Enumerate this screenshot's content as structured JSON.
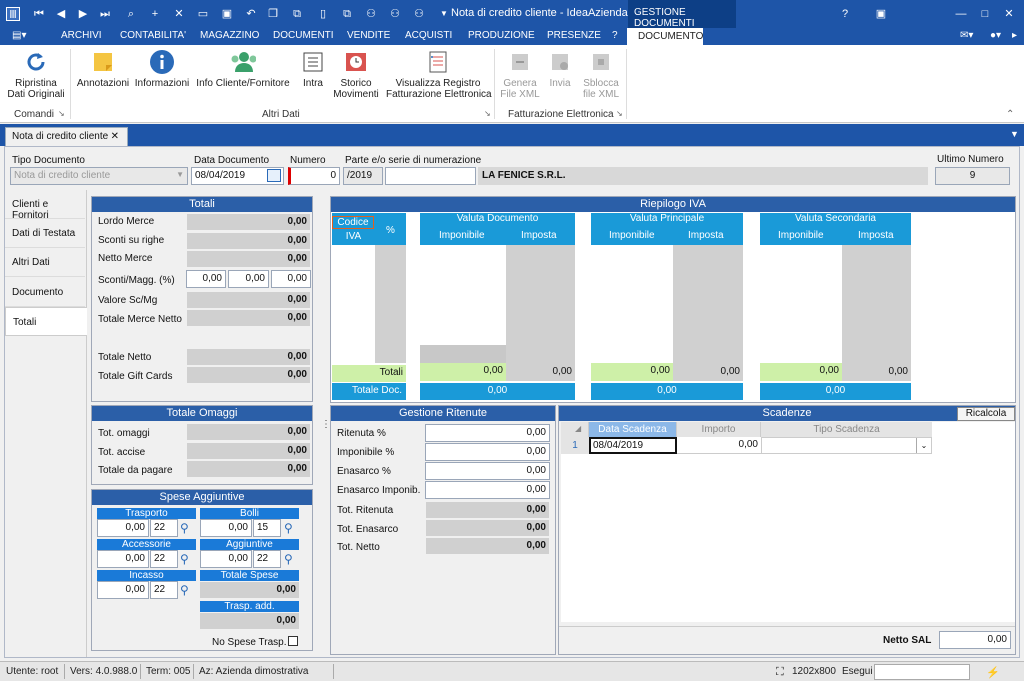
{
  "window": {
    "title": "Nota di credito cliente - IdeaAzienda.NE...",
    "context_tab": "GESTIONE DOCUMENTI"
  },
  "menu": [
    "ARCHIVI",
    "CONTABILITA'",
    "MAGAZZINO",
    "DOCUMENTI",
    "VENDITE",
    "ACQUISTI",
    "PRODUZIONE",
    "PRESENZE",
    "?",
    "DOCUMENTO"
  ],
  "ribbon": {
    "buttons": [
      {
        "label": "Ripristina\nDati Originali",
        "icon": "refresh-icon"
      },
      {
        "label": "Annotazioni",
        "icon": "sticky-note-icon"
      },
      {
        "label": "Informazioni",
        "icon": "info-icon"
      },
      {
        "label": "Info Cliente/Fornitore",
        "icon": "users-icon"
      },
      {
        "label": "Intra",
        "icon": "document-lines-icon"
      },
      {
        "label": "Storico\nMovimenti",
        "icon": "history-icon"
      },
      {
        "label": "Visualizza Registro\nFatturazione Elettronica",
        "icon": "register-icon"
      },
      {
        "label": "Genera\nFile XML",
        "icon": "generate-xml-icon"
      },
      {
        "label": "Invia",
        "icon": "send-icon"
      },
      {
        "label": "Sblocca\nfile XML",
        "icon": "unlock-xml-icon"
      }
    ],
    "groups": [
      "Comandi",
      "Altri Dati",
      "Fatturazione Elettronica"
    ]
  },
  "doc_tab": "Nota di credito cliente",
  "header": {
    "tipo_label": "Tipo Documento",
    "tipo_value": "Nota di credito cliente",
    "data_label": "Data Documento",
    "data_value": "08/04/2019",
    "numero_label": "Numero",
    "numero_value": "0",
    "serie_label": "Parte e/o serie di numerazione",
    "serie_value": "/2019",
    "serie_extra": "",
    "cliente": "LA FENICE S.R.L.",
    "ultimo_label": "Ultimo Numero",
    "ultimo_value": "9"
  },
  "side_tabs": [
    "Clienti e Fornitori",
    "Dati di Testata",
    "Altri Dati",
    "Documento",
    "Totali"
  ],
  "totali": {
    "title": "Totali",
    "rows": [
      {
        "label": "Lordo Merce",
        "value": "0,00"
      },
      {
        "label": "Sconti su righe",
        "value": "0,00"
      },
      {
        "label": "Netto Merce",
        "value": "0,00"
      },
      {
        "label": "Valore Sc/Mg",
        "value": "0,00"
      },
      {
        "label": "Totale Merce Netto",
        "value": "0,00"
      },
      {
        "label": "Totale Netto",
        "value": "0,00"
      },
      {
        "label": "Totale Gift Cards",
        "value": "0,00"
      }
    ],
    "sconti_label": "Sconti/Magg. (%)",
    "sconti": [
      "0,00",
      "0,00",
      "0,00"
    ]
  },
  "omaggi": {
    "title": "Totale Omaggi",
    "rows": [
      {
        "label": "Tot. omaggi",
        "value": "0,00"
      },
      {
        "label": "Tot. accise",
        "value": "0,00"
      },
      {
        "label": "Totale da pagare",
        "value": "0,00"
      }
    ]
  },
  "spese": {
    "title": "Spese Aggiuntive",
    "trasporto_label": "Trasporto",
    "trasporto": "0,00",
    "trasporto_iva": "22",
    "bolli_label": "Bolli",
    "bolli": "0,00",
    "bolli_iva": "15",
    "accessorie_label": "Accessorie",
    "accessorie": "0,00",
    "accessorie_iva": "22",
    "aggiuntive_label": "Aggiuntive",
    "aggiuntive": "0,00",
    "aggiuntive_iva": "22",
    "incasso_label": "Incasso",
    "incasso": "0,00",
    "incasso_iva": "22",
    "totale_label": "Totale Spese",
    "totale": "0,00",
    "trasp_add_label": "Trasp. add.",
    "trasp_add": "0,00",
    "no_spese_label": "No Spese Trasp."
  },
  "iva": {
    "title": "Riepilogo IVA",
    "codice": "Codice",
    "iva": "IVA",
    "perc": "%",
    "valuta_doc": "Valuta Documento",
    "valuta_princ": "Valuta Principale",
    "valuta_sec": "Valuta Secondaria",
    "imponibile": "Imponibile",
    "imposta": "Imposta",
    "totali_label": "Totali",
    "totale_doc_label": "Totale Doc.",
    "doc_imp": "0,00",
    "doc_imposta": "0,00",
    "doc_tot": "0,00",
    "princ_imp": "0,00",
    "princ_imposta": "0,00",
    "princ_tot": "0,00",
    "sec_imp": "0,00",
    "sec_imposta": "0,00",
    "sec_tot": "0,00"
  },
  "ritenute": {
    "title": "Gestione Ritenute",
    "inputs": [
      {
        "label": "Ritenuta %",
        "value": "0,00"
      },
      {
        "label": "Imponibile %",
        "value": "0,00"
      },
      {
        "label": "Enasarco %",
        "value": "0,00"
      },
      {
        "label": "Enasarco Imponib.",
        "value": "0,00"
      }
    ],
    "totals": [
      {
        "label": "Tot. Ritenuta",
        "value": "0,00"
      },
      {
        "label": "Tot. Enasarco",
        "value": "0,00"
      },
      {
        "label": "Tot. Netto",
        "value": "0,00"
      }
    ]
  },
  "scadenze": {
    "title": "Scadenze",
    "ricalcola": "Ricalcola",
    "cols": [
      "Data Scadenza",
      "Importo",
      "Tipo Scadenza"
    ],
    "row": {
      "num": "1",
      "data": "08/04/2019",
      "importo": "0,00",
      "tipo": ""
    },
    "netto_sal_label": "Netto SAL",
    "netto_sal": "0,00"
  },
  "status": {
    "utente": "Utente: root",
    "vers": "Vers: 4.0.988.0",
    "term": "Term: 005",
    "az": "Az: Azienda dimostrativa",
    "res": "1202x800",
    "esegui": "Esegui"
  }
}
